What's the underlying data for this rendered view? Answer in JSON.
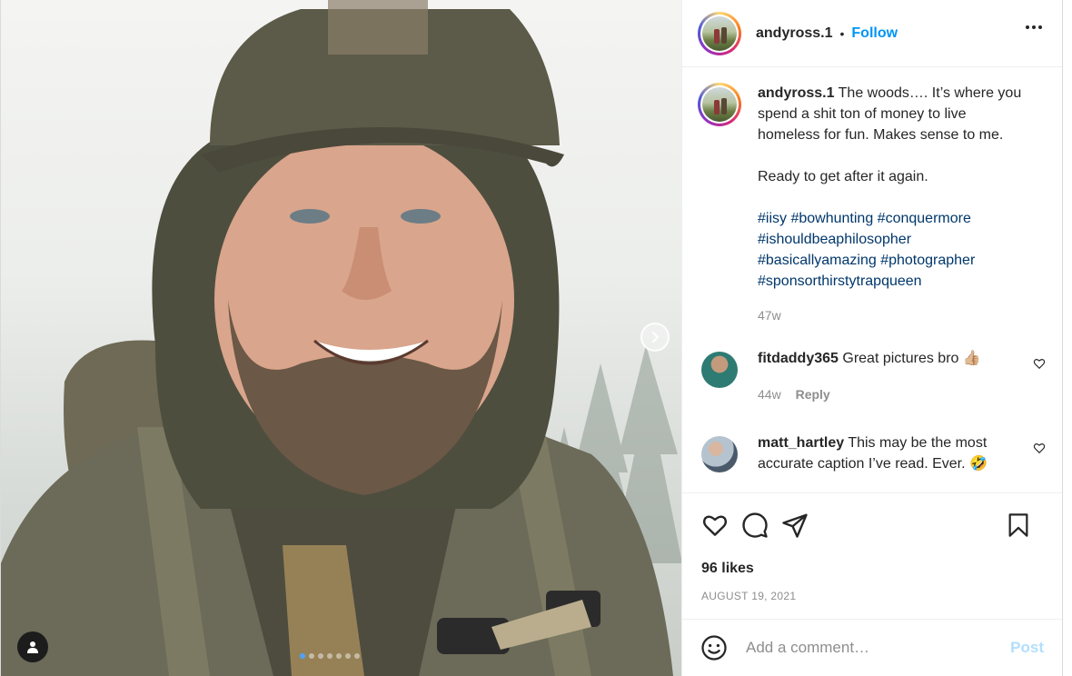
{
  "post": {
    "username": "andyross.1",
    "follow_label": "Follow",
    "separator": "•",
    "caption": {
      "username": "andyross.1",
      "text": "The woods…. It’s where you spend a shit ton of money to live homeless for fun. Makes sense to me.",
      "line2": "Ready to get after it again.",
      "hashtags": [
        "#iisy",
        "#bowhunting",
        "#conquermore",
        "#ishouldbeaphilosopher",
        "#basicallyamazing",
        "#photographer",
        "#sponsorthirstytrapqueen"
      ],
      "age": "47w"
    },
    "comments": [
      {
        "username": "fitdaddy365",
        "text": "Great pictures bro 👍🏼",
        "age": "44w",
        "reply_label": "Reply"
      },
      {
        "username": "matt_hartley",
        "text": "This may be the most accurate caption I’ve read. Ever. 🤣",
        "age": "",
        "reply_label": ""
      }
    ],
    "likes": "96 likes",
    "date": "AUGUST 19, 2021",
    "comment_placeholder": "Add a comment…",
    "post_label": "Post"
  },
  "carousel": {
    "slide_count": 7,
    "active_index": 0
  },
  "icons": {
    "more": "more-options-icon",
    "heart": "heart-icon",
    "comment": "comment-icon",
    "share": "share-icon",
    "bookmark": "bookmark-icon",
    "emoji": "emoji-icon",
    "tag": "user-tag-icon",
    "next": "chevron-right-icon"
  },
  "colors": {
    "link": "#0095f6",
    "hashtag": "#00376b",
    "muted": "#8e8e8e",
    "post_disabled": "#b2dffc"
  }
}
